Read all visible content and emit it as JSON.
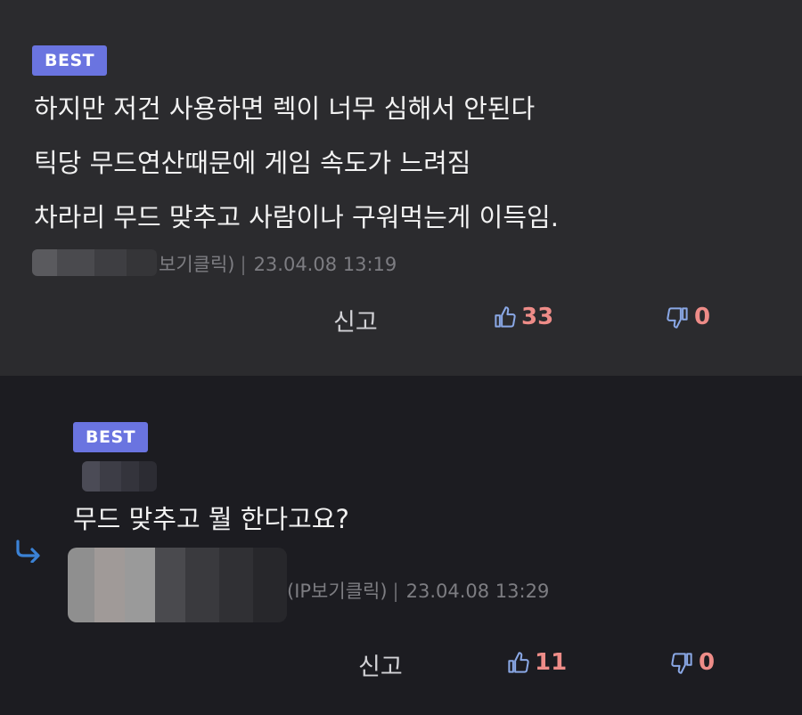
{
  "comments": [
    {
      "badge": "BEST",
      "lines": [
        "하지만 저건 사용하면 렉이 너무 심해서 안된다",
        "틱당 무드연산때문에 게임 속도가 느려짐",
        "차라리 무드 맞추고 사람이나 구워먹는게 이득임."
      ],
      "ip_label": "보기클릭)",
      "date": "23.04.08 13:19",
      "report": "신고",
      "likes": "33",
      "dislikes": "0"
    },
    {
      "badge": "BEST",
      "lines": [
        "무드 맞추고 뭘 한다고요?"
      ],
      "ip_label": "(IP보기클릭)",
      "date": "23.04.08 13:29",
      "report": "신고",
      "likes": "11",
      "dislikes": "0"
    }
  ],
  "meta_separator": "|",
  "colors": {
    "badge": "#6a74e0",
    "count": "#ee8c88",
    "icon": "#8aa8e6",
    "reply_arrow": "#3b82d6"
  },
  "icons": {
    "like": "thumbs-up-icon",
    "dislike": "thumbs-down-icon",
    "reply": "reply-arrow-icon"
  }
}
